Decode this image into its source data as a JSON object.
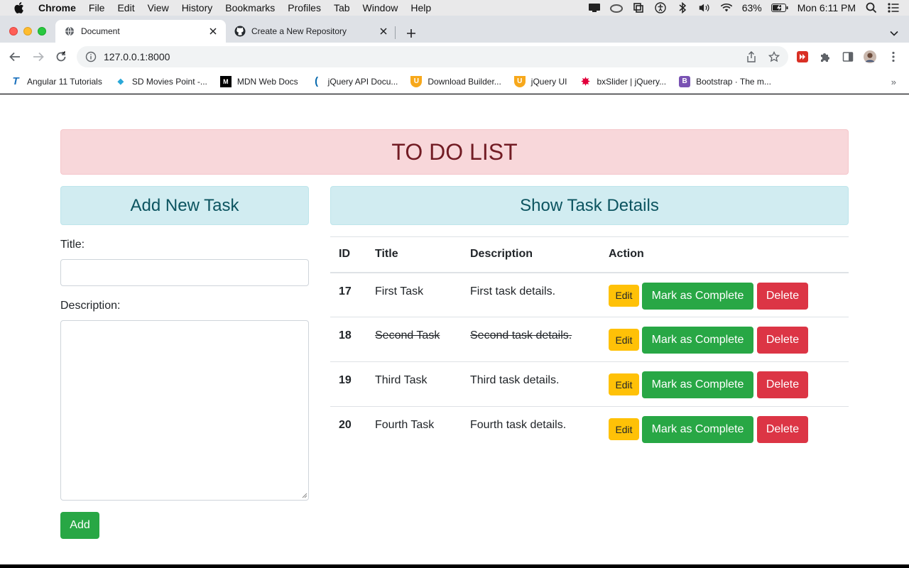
{
  "menubar": {
    "app": "Chrome",
    "items": [
      "File",
      "Edit",
      "View",
      "History",
      "Bookmarks",
      "Profiles",
      "Tab",
      "Window",
      "Help"
    ],
    "battery": "63%",
    "clock": "Mon 6:11 PM",
    "icons": [
      "apple-icon",
      "screen-mirror-icon",
      "creative-cloud-icon",
      "screenshot-icon",
      "accessibility-icon",
      "bluetooth-icon",
      "volume-icon",
      "wifi-icon",
      "battery-icon",
      "spotlight-icon",
      "control-center-icon"
    ]
  },
  "tabs": [
    {
      "title": "Document",
      "icon": "globe-icon",
      "active": true
    },
    {
      "title": "Create a New Repository",
      "icon": "github-icon",
      "active": false
    }
  ],
  "toolbar": {
    "url": "127.0.0.1:8000"
  },
  "bookmarks": [
    {
      "label": "Angular 11 Tutorials",
      "icon": "T",
      "color": "#1e73be"
    },
    {
      "label": "SD Movies Point -...",
      "icon": "◆",
      "color": "#2aa8d8"
    },
    {
      "label": "MDN Web Docs",
      "icon": "M",
      "color": "#000000"
    },
    {
      "label": "jQuery API Docu...",
      "icon": "(",
      "color": "#0769ad"
    },
    {
      "label": "Download Builder...",
      "icon": "U",
      "color": "#f7a81b"
    },
    {
      "label": "jQuery UI",
      "icon": "U",
      "color": "#f7a81b"
    },
    {
      "label": "bxSlider | jQuery...",
      "icon": "✸",
      "color": "#e2003b"
    },
    {
      "label": "Bootstrap · The m...",
      "icon": "B",
      "color": "#7952b3"
    }
  ],
  "page": {
    "banner": "TO DO LIST",
    "add_panel_title": "Add New Task",
    "details_panel_title": "Show Task Details",
    "title_label": "Title:",
    "title_value": "",
    "description_label": "Description:",
    "description_value": "",
    "add_button": "Add",
    "table_headers": [
      "ID",
      "Title",
      "Description",
      "Action"
    ],
    "tasks": [
      {
        "id": "17",
        "title": "First Task",
        "description": "First task details.",
        "completed": false
      },
      {
        "id": "18",
        "title": "Second Task",
        "description": "Second task details.",
        "completed": true
      },
      {
        "id": "19",
        "title": "Third Task",
        "description": "Third task details.",
        "completed": false
      },
      {
        "id": "20",
        "title": "Fourth Task",
        "description": "Fourth task details.",
        "completed": false
      }
    ],
    "action_labels": {
      "edit": "Edit",
      "complete": "Mark as Complete",
      "delete": "Delete"
    }
  },
  "colors": {
    "banner_bg": "#f8d7da",
    "banner_text": "#721c24",
    "panel_bg": "#d1ecf1",
    "panel_text": "#0c5460",
    "success": "#28a745",
    "warning": "#ffc107",
    "danger": "#dc3545"
  }
}
